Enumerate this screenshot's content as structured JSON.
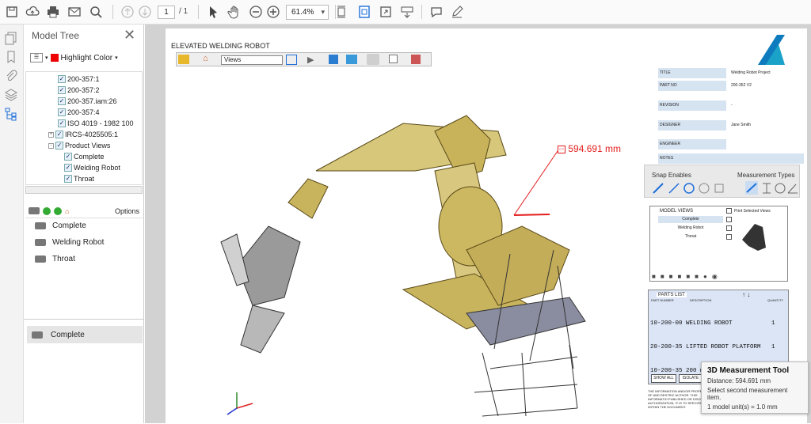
{
  "toolbar": {
    "page_current": "1",
    "page_total": "/ 1",
    "zoom": "61.4%"
  },
  "panel": {
    "title": "Model Tree",
    "highlight_color": "Highlight Color",
    "tree_items": [
      "200-357:1",
      "200-357:2",
      "200-357.iam:26",
      "200-357:4",
      "ISO 4019 - 1982 100",
      "IRCS-4025505:1",
      "Product Views",
      "Complete",
      "Welding Robot",
      "Throat"
    ],
    "options": "Options",
    "views": [
      "Complete",
      "Welding Robot",
      "Throat"
    ],
    "selected_view": "Complete"
  },
  "drawing": {
    "title": "ELEVATED WELDING ROBOT",
    "views_select": "Views",
    "measurement": "594.691 mm",
    "title_block": [
      {
        "k": "TITLE",
        "v": "Welding Robot Project"
      },
      {
        "k": "PART NO",
        "v": "200-352 V2"
      },
      {
        "k": "REVISION",
        "v": "-"
      },
      {
        "k": "DESIGNER",
        "v": "Jane Smith"
      },
      {
        "k": "ENGINEER",
        "v": ""
      },
      {
        "k": "NOTES",
        "v": ""
      }
    ],
    "snap_label": "Snap Enables",
    "measure_types_label": "Measurement Types",
    "model_views": {
      "header": "MODEL VIEWS",
      "print_label": "Print Selected Views",
      "items": [
        "Complete",
        "Welding Robot",
        "Throat"
      ]
    },
    "parts_list": {
      "title": "PARTS LIST",
      "col_part": "PART NUMBER",
      "col_desc": "DESCRIPTION",
      "col_qty": "QUANTITY",
      "rows": [
        "10-200-00 WELDING ROBOT           1",
        "20-200-35 LIFTED ROBOT PLATFORM   1",
        "10-200-35 200 mm Throat           1"
      ],
      "show_all": "SHOW ALL",
      "isolate": "ISOLATE"
    },
    "legal_text": "THE INFORMATION AND/OR PROPERTY OF AND RESTRIC AUTHOR. THIS INFORMATIO PUBLISHED OR DISCLOSED AUTHORIZATION. IT IS TO SPECIFIED WITHIN THE DOCUMENT."
  },
  "tooltip": {
    "title": "3D Measurement Tool",
    "distance": "Distance: 594.691 mm",
    "hint": "Select second measurement item.",
    "units": "1 model unit(s) = 1.0 mm"
  }
}
